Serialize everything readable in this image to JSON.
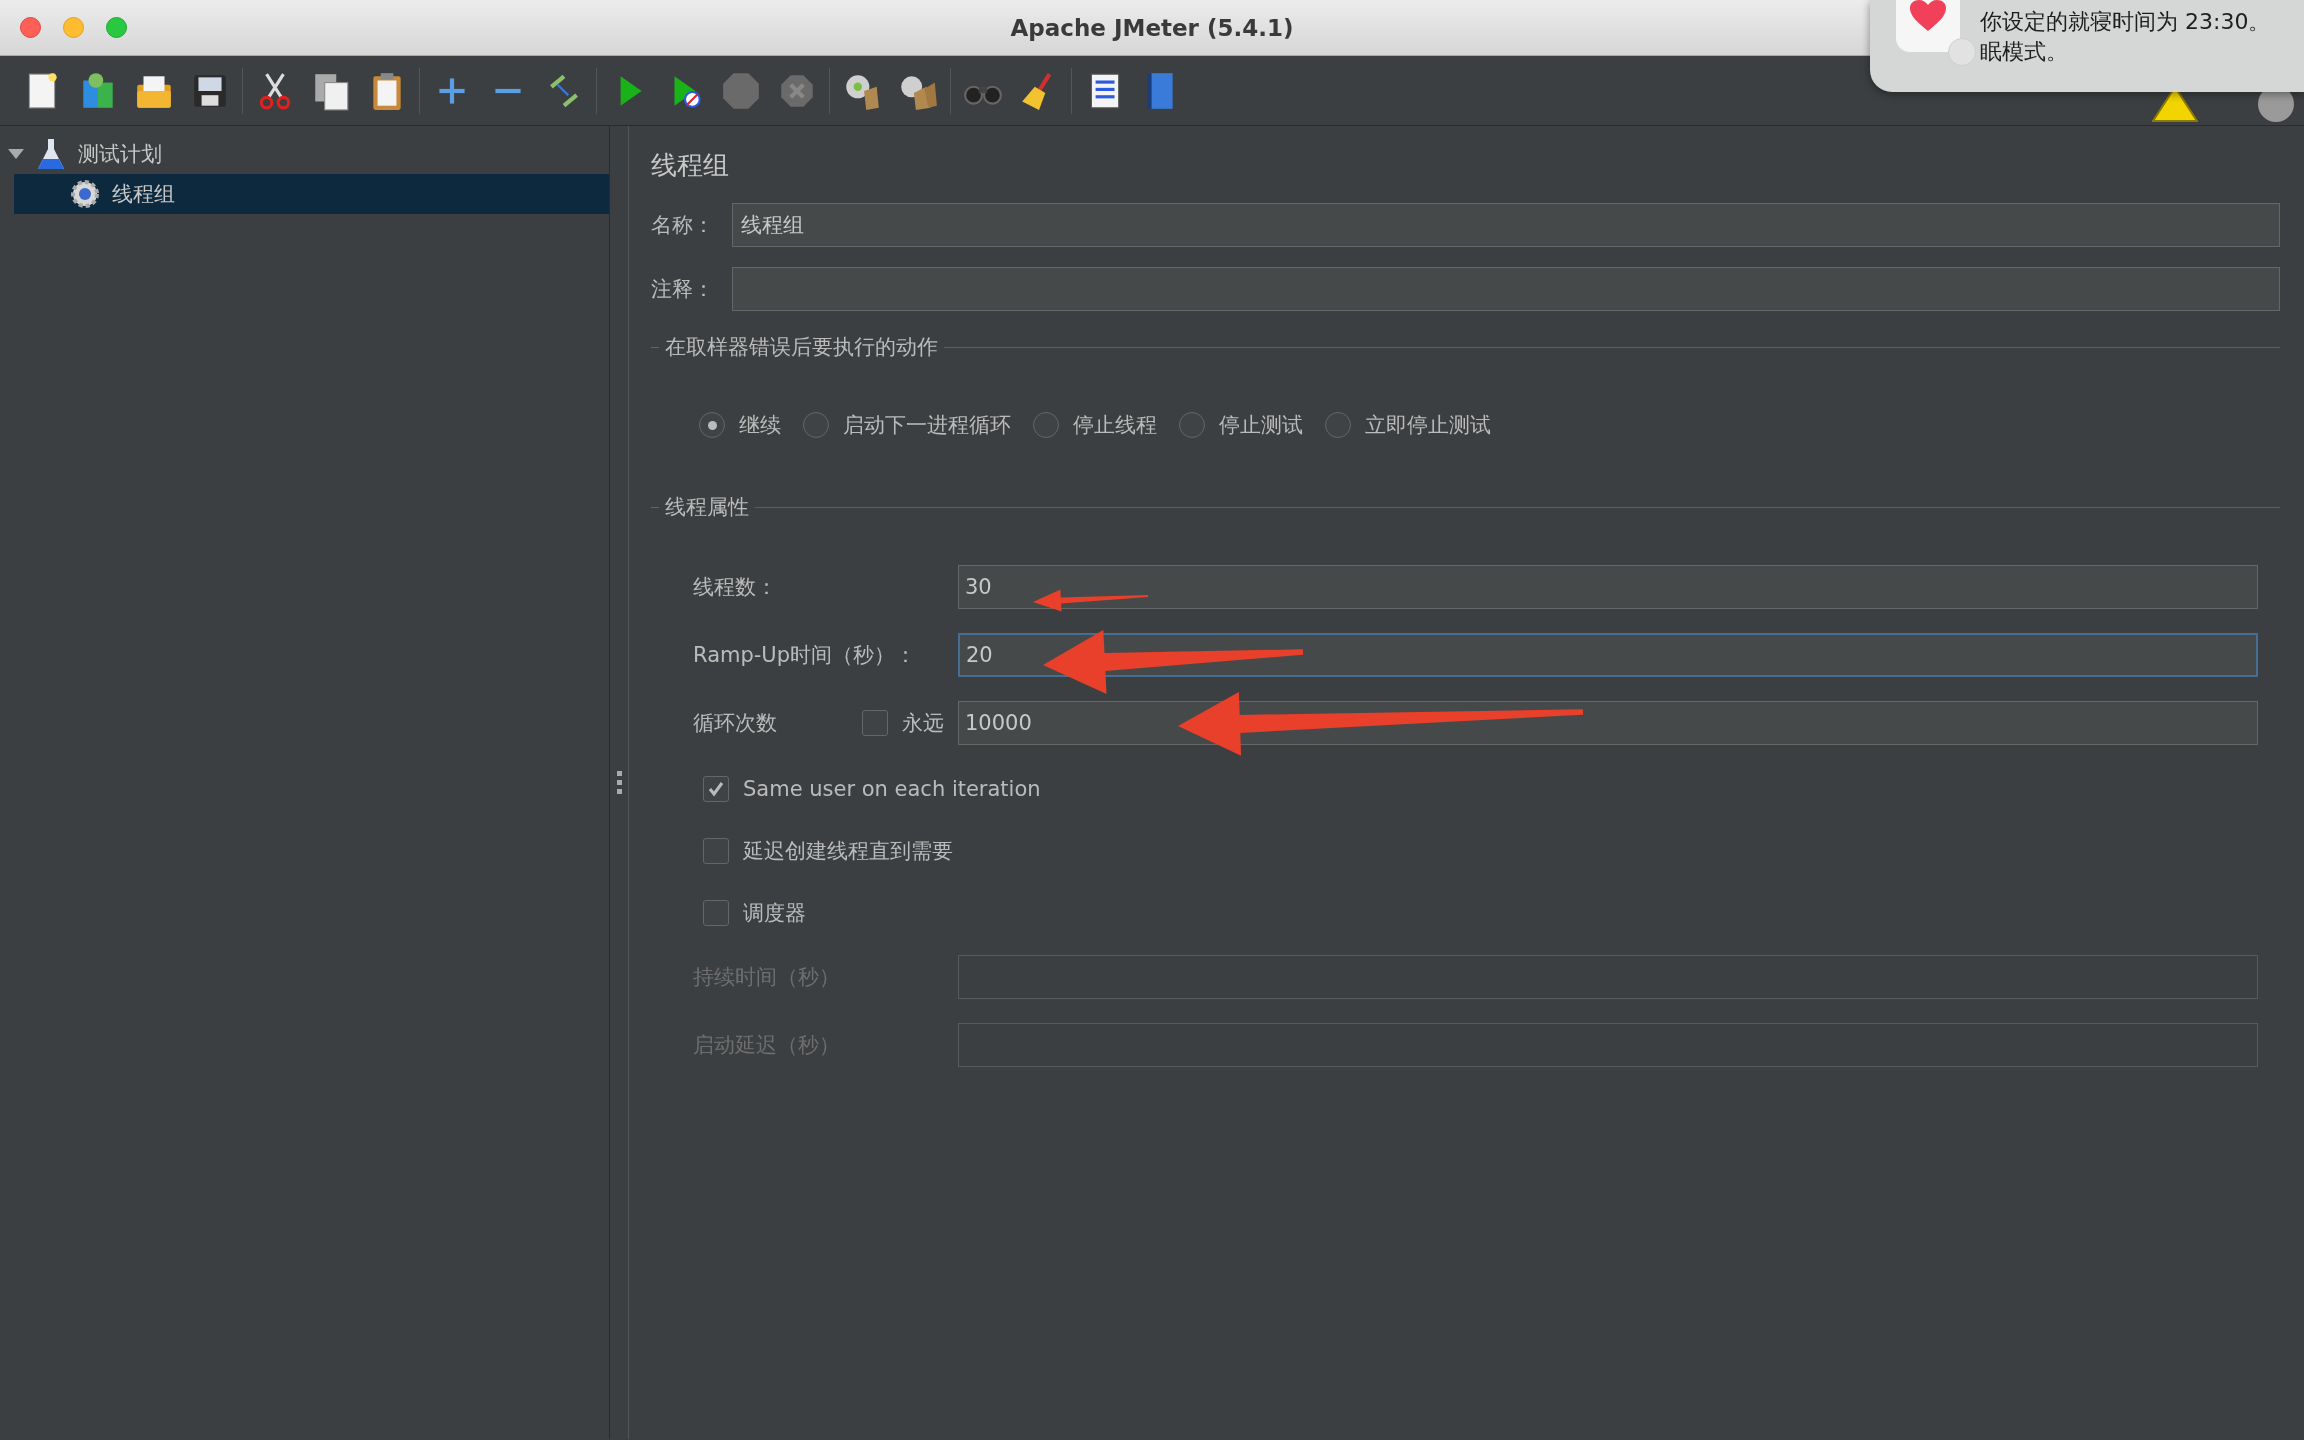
{
  "window": {
    "title": "Apache JMeter (5.4.1)"
  },
  "notification": {
    "lines": [
      "你设定的就寝时间为 23:30。",
      "眠模式。"
    ]
  },
  "tree": [
    {
      "label": "测试计划",
      "kind": "plan",
      "expanded": true,
      "selected": false,
      "children": [
        {
          "label": "线程组",
          "kind": "thread-group",
          "selected": true
        }
      ]
    }
  ],
  "panel": {
    "title": "线程组",
    "name": {
      "label": "名称：",
      "value": "线程组"
    },
    "comment": {
      "label": "注释："
    },
    "error_action": {
      "legend": "在取样器错误后要执行的动作",
      "options": [
        {
          "label": "继续",
          "selected": true
        },
        {
          "label": "启动下一进程循环",
          "selected": false
        },
        {
          "label": "停止线程",
          "selected": false
        },
        {
          "label": "停止测试",
          "selected": false
        },
        {
          "label": "立即停止测试",
          "selected": false
        }
      ]
    },
    "thread_properties": {
      "legend": "线程属性",
      "fields": [
        {
          "kind": "text",
          "label": "线程数：",
          "value": "30",
          "focused": false,
          "arrow": true
        },
        {
          "kind": "text",
          "label": "Ramp-Up时间（秒）：",
          "value": "20",
          "focused": true,
          "arrow": true
        },
        {
          "kind": "loop",
          "label": "循环次数",
          "forever": {
            "label": "永远",
            "checked": false
          },
          "value": "10000",
          "focused": false,
          "arrow": true
        }
      ],
      "checkboxes": [
        {
          "label": "Same user on each iteration",
          "checked": true
        },
        {
          "label": "延迟创建线程直到需要",
          "checked": false
        },
        {
          "label": "调度器",
          "checked": false
        }
      ],
      "scheduler_fields": [
        {
          "label": "持续时间（秒）",
          "disabled": true
        },
        {
          "label": "启动延迟（秒）",
          "disabled": true
        }
      ]
    }
  }
}
